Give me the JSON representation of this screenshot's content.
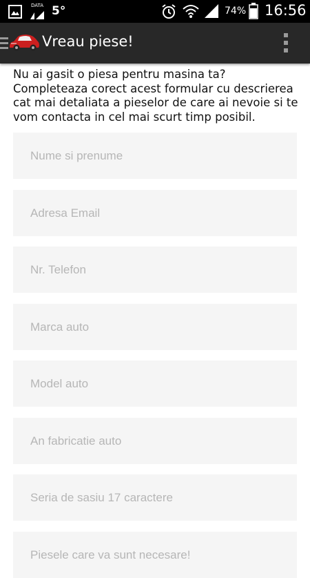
{
  "status_bar": {
    "temperature": "5°",
    "battery": "74%",
    "time": "16:56",
    "data_label": "DATA"
  },
  "app_bar": {
    "title": "Vreau piese!",
    "accent_color": "#cc1f1f"
  },
  "form": {
    "intro": "Nu ai gasit o piesa pentru masina ta? Completeaza corect acest formular cu descrierea cat mai detaliata a pieselor de care ai nevoie si te vom contacta in cel mai scurt timp posibil.",
    "fields": [
      {
        "placeholder": "Nume si prenume",
        "value": ""
      },
      {
        "placeholder": "Adresa Email",
        "value": ""
      },
      {
        "placeholder": "Nr. Telefon",
        "value": ""
      },
      {
        "placeholder": "Marca auto",
        "value": ""
      },
      {
        "placeholder": "Model auto",
        "value": ""
      },
      {
        "placeholder": "An fabricatie auto",
        "value": ""
      },
      {
        "placeholder": "Seria de sasiu 17 caractere",
        "value": ""
      },
      {
        "placeholder": "Piesele care va sunt necesare!",
        "value": ""
      }
    ]
  }
}
